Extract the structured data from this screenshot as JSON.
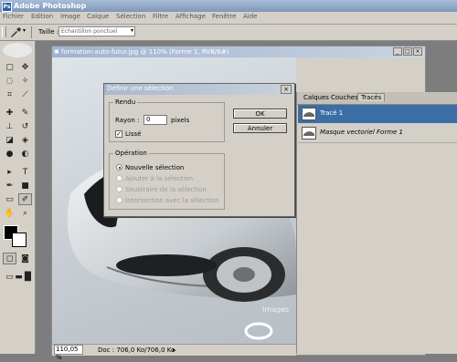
{
  "app": {
    "title": "Adobe Photoshop",
    "logo": "Ps"
  },
  "menu": [
    "Fichier",
    "Edition",
    "Image",
    "Calque",
    "Sélection",
    "Filtre",
    "Affichage",
    "Fenêtre",
    "Aide"
  ],
  "options": {
    "tool_icon": "eyedropper-icon",
    "size_label": "Taille :",
    "size_value": "Echantillon ponctuel"
  },
  "document": {
    "title": "formation-auto-futur.jpg @ 110% (Forme 1, RVB/8#)",
    "zoom": "110,05 %",
    "doc_info": "Doc : 706,0 Ko/706,0 Ko",
    "watermark": "Images"
  },
  "dialog": {
    "title": "Définir une sélection",
    "rendu_legend": "Rendu",
    "rayon_label": "Rayon :",
    "rayon_value": "0",
    "rayon_unit": "pixels",
    "lisse_label": "Lissé",
    "lisse_checked": true,
    "ok_label": "OK",
    "cancel_label": "Annuler",
    "operation_legend": "Opération",
    "operations": [
      {
        "label": "Nouvelle sélection",
        "selected": true,
        "enabled": true
      },
      {
        "label": "Ajouter à la sélection",
        "selected": false,
        "enabled": false
      },
      {
        "label": "Soustraire de la sélection",
        "selected": false,
        "enabled": false
      },
      {
        "label": "Intersection avec la sélection",
        "selected": false,
        "enabled": false
      }
    ]
  },
  "panel": {
    "tabs": [
      "Calques",
      "Couches",
      "Tracés"
    ],
    "active_tab": "Tracés",
    "items": [
      {
        "label": "Tracé 1",
        "selected": true
      },
      {
        "label": "Masque vectoriel Forme 1",
        "selected": false
      }
    ]
  },
  "colors": {
    "title_bar": "#7f97b8",
    "selection": "#3a6ea5",
    "chrome": "#d4d0c8"
  }
}
